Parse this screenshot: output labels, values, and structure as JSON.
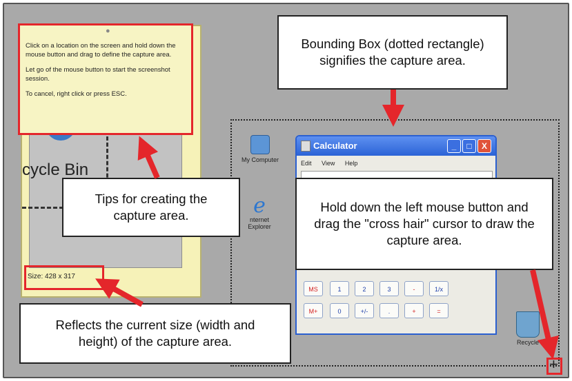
{
  "tips": {
    "line1": "Click on a location on the screen and hold down the mouse button and drag to define the capture area.",
    "line2": "Let go of the mouse button to start the screenshot session.",
    "line3": "To cancel, right click or press ESC."
  },
  "left_panel": {
    "recycle_bin_label": "cycle Bin",
    "size_label": "Size: 428 x 317"
  },
  "desktop": {
    "my_computer": "My Computer",
    "internet_explorer_line1": "nternet",
    "internet_explorer_line2": "Explorer",
    "recycle_bin": "Recycle"
  },
  "calculator": {
    "title": "Calculator",
    "menu": [
      "Edit",
      "View",
      "Help"
    ],
    "keys_row1": [
      "MS",
      "1",
      "2",
      "3",
      "-",
      "1/x"
    ],
    "keys_row2": [
      "M+",
      "0",
      "+/-",
      ".",
      "+",
      "="
    ],
    "win_buttons": [
      "_",
      "□",
      "X"
    ]
  },
  "callouts": {
    "bounding_box": "Bounding Box (dotted rectangle) signifies the capture area.",
    "tips": "Tips for creating the capture area.",
    "hold_down": "Hold down the left mouse button and drag the \"cross hair\" cursor to draw the capture area.",
    "reflects": "Reflects the current size (width and height) of the capture area."
  },
  "cursor_glyph": "+",
  "colors": {
    "highlight_red": "#e4262b",
    "background_gray": "#a9a9a9",
    "tip_yellow": "#f7f4c4"
  }
}
